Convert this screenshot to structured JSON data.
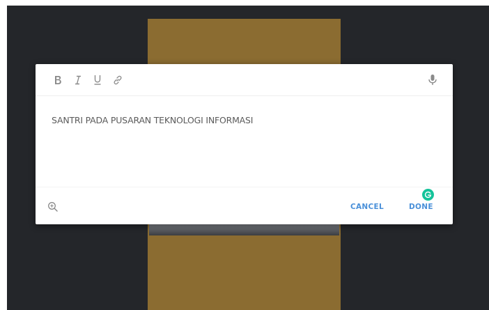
{
  "toolbar": {
    "bold_icon": "bold-icon",
    "italic_icon": "italic-icon",
    "underline_icon": "underline-icon",
    "link_icon": "link-icon",
    "mic_icon": "microphone-icon"
  },
  "caption": {
    "text": "SANTRI PADA PUSARAN TEKNOLOGI INFORMASI"
  },
  "footer": {
    "zoom_icon": "zoom-in-icon",
    "cancel_label": "CANCEL",
    "done_label": "DONE"
  },
  "colors": {
    "backdrop": "#24262a",
    "image_panel": "#8b6c31",
    "action_blue": "#4a90d9",
    "grammarly_green": "#15c39a",
    "icon_grey": "#8a8a8a"
  }
}
